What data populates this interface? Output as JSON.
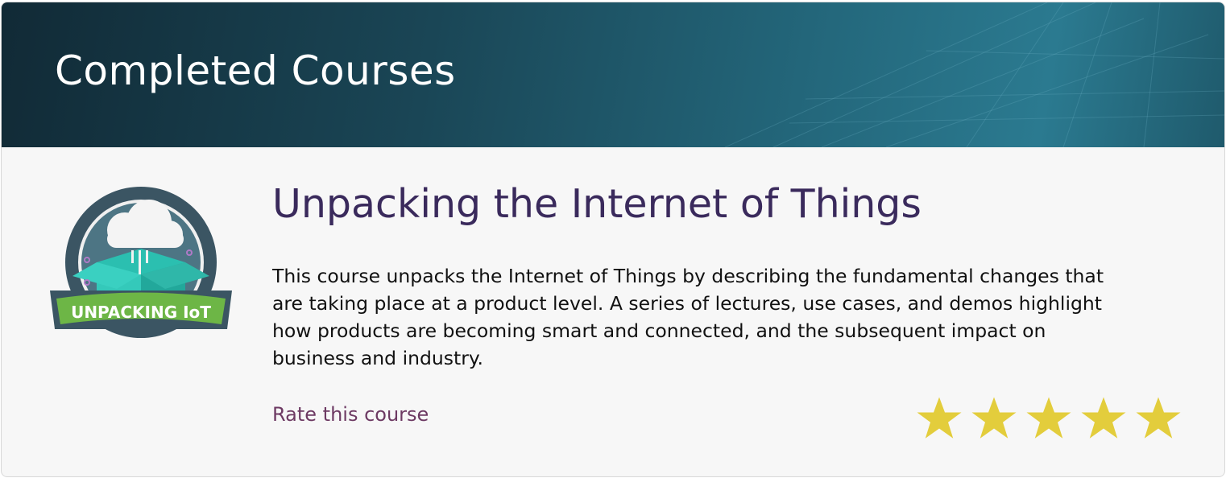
{
  "header": {
    "title": "Completed Courses"
  },
  "course": {
    "badge_text": "UNPACKING IoT",
    "title": "Unpacking the Internet of Things",
    "description": "This course unpacks the Internet of Things by describing the fundamental changes that are taking place at a product level. A series of lectures, use cases, and demos highlight how products are becoming smart and connected, and the subsequent impact on business and industry.",
    "rate_label": "Rate this course",
    "rating": 5,
    "rating_max": 5
  },
  "colors": {
    "star": "#e3cd3c",
    "title": "#3a2a5c",
    "link": "#6d3a63"
  }
}
